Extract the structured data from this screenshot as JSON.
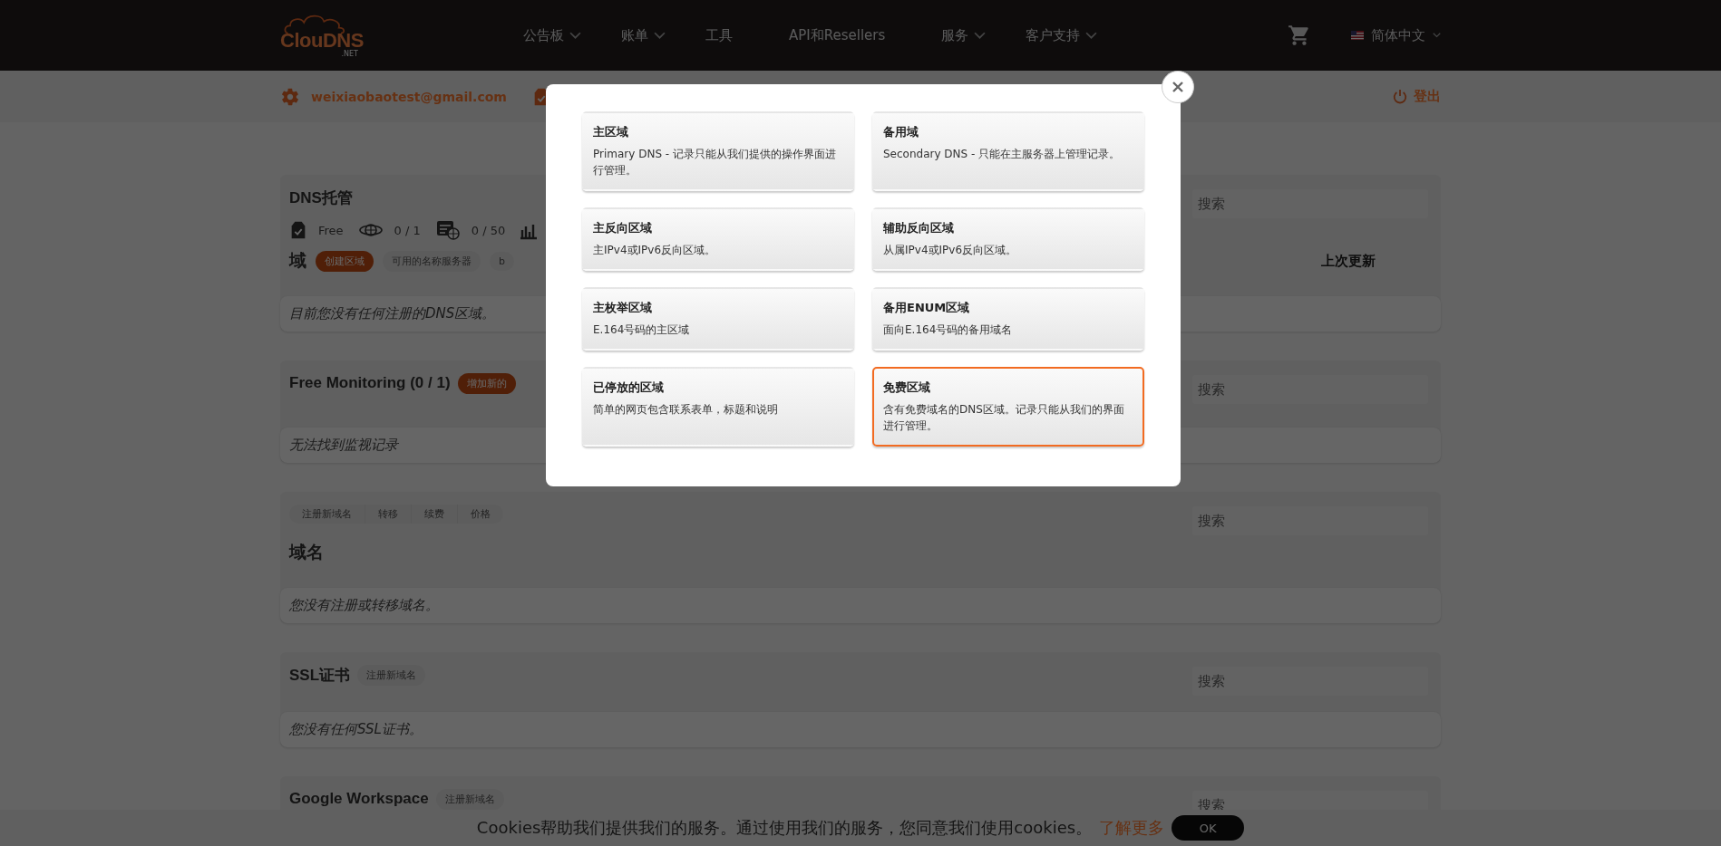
{
  "header": {
    "logo": "ClouDNS",
    "logo_suffix": ".NET",
    "nav": [
      {
        "label": "公告板",
        "dropdown": true
      },
      {
        "label": "账单",
        "dropdown": true
      },
      {
        "label": "工具",
        "dropdown": false
      },
      {
        "label": "API和Resellers",
        "dropdown": false
      },
      {
        "label": "服务",
        "dropdown": true
      },
      {
        "label": "客户支持",
        "dropdown": true
      }
    ],
    "language": "简体中文"
  },
  "account_bar": {
    "email": "weixiaobaotest@gmail.com",
    "logout": "登出"
  },
  "sections": [
    {
      "title": "DNS托管",
      "stats": [
        {
          "kind": "plan",
          "value": "Free"
        },
        {
          "kind": "zones",
          "value": "0 / 1"
        },
        {
          "kind": "records",
          "value": "0 / 50"
        }
      ],
      "subtitle": "域",
      "subtitle_actions": [
        {
          "label": "创建区域",
          "primary": true
        },
        {
          "label": "可用的名称服务器",
          "primary": false
        },
        {
          "label": "b",
          "primary": false
        }
      ],
      "column": "上次更新",
      "search": {
        "placeholder": "搜索"
      },
      "empty_message": "目前您没有任何注册的DNS区域。"
    },
    {
      "title": "Free Monitoring (0 / 1)",
      "title_actions": [
        {
          "label": "增加新的",
          "primary": true
        }
      ],
      "search": {
        "placeholder": "搜索"
      },
      "empty_message": "无法找到监视记录"
    },
    {
      "top_links": [
        "注册新域名",
        "转移",
        "续费",
        "价格"
      ],
      "subtitle": "域名",
      "search": {
        "placeholder": "搜索"
      },
      "empty_message": "您没有注册或转移域名。"
    },
    {
      "title": "SSL证书",
      "title_actions": [
        {
          "label": "注册新域名",
          "primary": false
        }
      ],
      "search": {
        "placeholder": "搜索"
      },
      "empty_message": "您没有任何SSL证书。"
    },
    {
      "title": "Google Workspace",
      "title_actions": [
        {
          "label": "注册新域名",
          "primary": false
        }
      ],
      "search": {
        "placeholder": "搜索"
      }
    }
  ],
  "modal": {
    "options": [
      {
        "title": "主区域",
        "description": "Primary DNS - 记录只能从我们提供的操作界面进行管理。",
        "selected": false
      },
      {
        "title": "备用域",
        "description": "Secondary DNS - 只能在主服务器上管理记录。",
        "selected": false
      },
      {
        "title": "主反向区域",
        "description": "主IPv4或IPv6反向区域。",
        "selected": false
      },
      {
        "title": "辅助反向区域",
        "description": "从属IPv4或IPv6反向区域。",
        "selected": false
      },
      {
        "title": "主枚举区域",
        "description": "E.164号码的主区域",
        "selected": false
      },
      {
        "title": "备用ENUM区域",
        "description": "面向E.164号码的备用域名",
        "selected": false
      },
      {
        "title": "已停放的区域",
        "description": "简单的网页包含联系表单，标题和说明",
        "selected": false
      },
      {
        "title": "免费区域",
        "description": "含有免费域名的DNS区域。记录只能从我们的界面进行管理。",
        "selected": true
      }
    ]
  },
  "cookie_bar": {
    "text": "Cookies帮助我们提供我们的服务。通过使用我们的服务，您同意我们使用cookies。",
    "link": "了解更多",
    "button": "OK"
  }
}
